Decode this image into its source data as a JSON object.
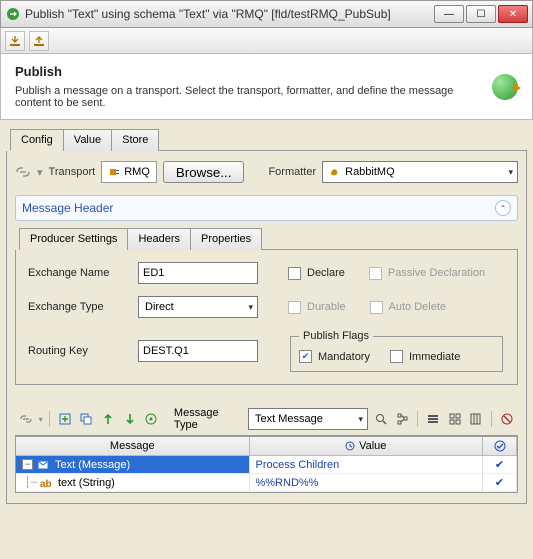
{
  "window": {
    "title": "Publish \"Text\" using schema \"Text\" via \"RMQ\" [fld/testRMQ_PubSub]",
    "buttons": {
      "min": "—",
      "max": "☐",
      "close": "✕"
    }
  },
  "header": {
    "title": "Publish",
    "desc": "Publish a message on a transport. Select the transport, formatter, and define the message content to be sent."
  },
  "tabs": {
    "items": [
      "Config",
      "Value",
      "Store"
    ],
    "active": 0
  },
  "transport": {
    "label": "Transport",
    "value": "RMQ",
    "browse": "Browse...",
    "formatter_label": "Formatter",
    "formatter_value": "RabbitMQ"
  },
  "msgHeader": {
    "title": "Message Header"
  },
  "producer": {
    "tabs": [
      "Producer Settings",
      "Headers",
      "Properties"
    ],
    "active": 0,
    "fields": {
      "exchange_name_label": "Exchange Name",
      "exchange_name": "ED1",
      "exchange_type_label": "Exchange Type",
      "exchange_type": "Direct",
      "routing_key_label": "Routing Key",
      "routing_key": "DEST.Q1"
    },
    "flags": {
      "declare": "Declare",
      "passive": "Passive Declaration",
      "durable": "Durable",
      "autodel": "Auto Delete",
      "group": "Publish Flags",
      "mandatory": "Mandatory",
      "immediate": "Immediate"
    }
  },
  "msgbar": {
    "type_label": "Message Type",
    "type_value": "Text Message"
  },
  "msgTable": {
    "columns": [
      "Message",
      "Value",
      ""
    ],
    "rows": [
      {
        "name": "Text (Message)",
        "value": "Process Children",
        "checked": true,
        "level": 0
      },
      {
        "name": "text (String)",
        "value": "%%RND%%",
        "checked": true,
        "level": 1
      }
    ]
  }
}
